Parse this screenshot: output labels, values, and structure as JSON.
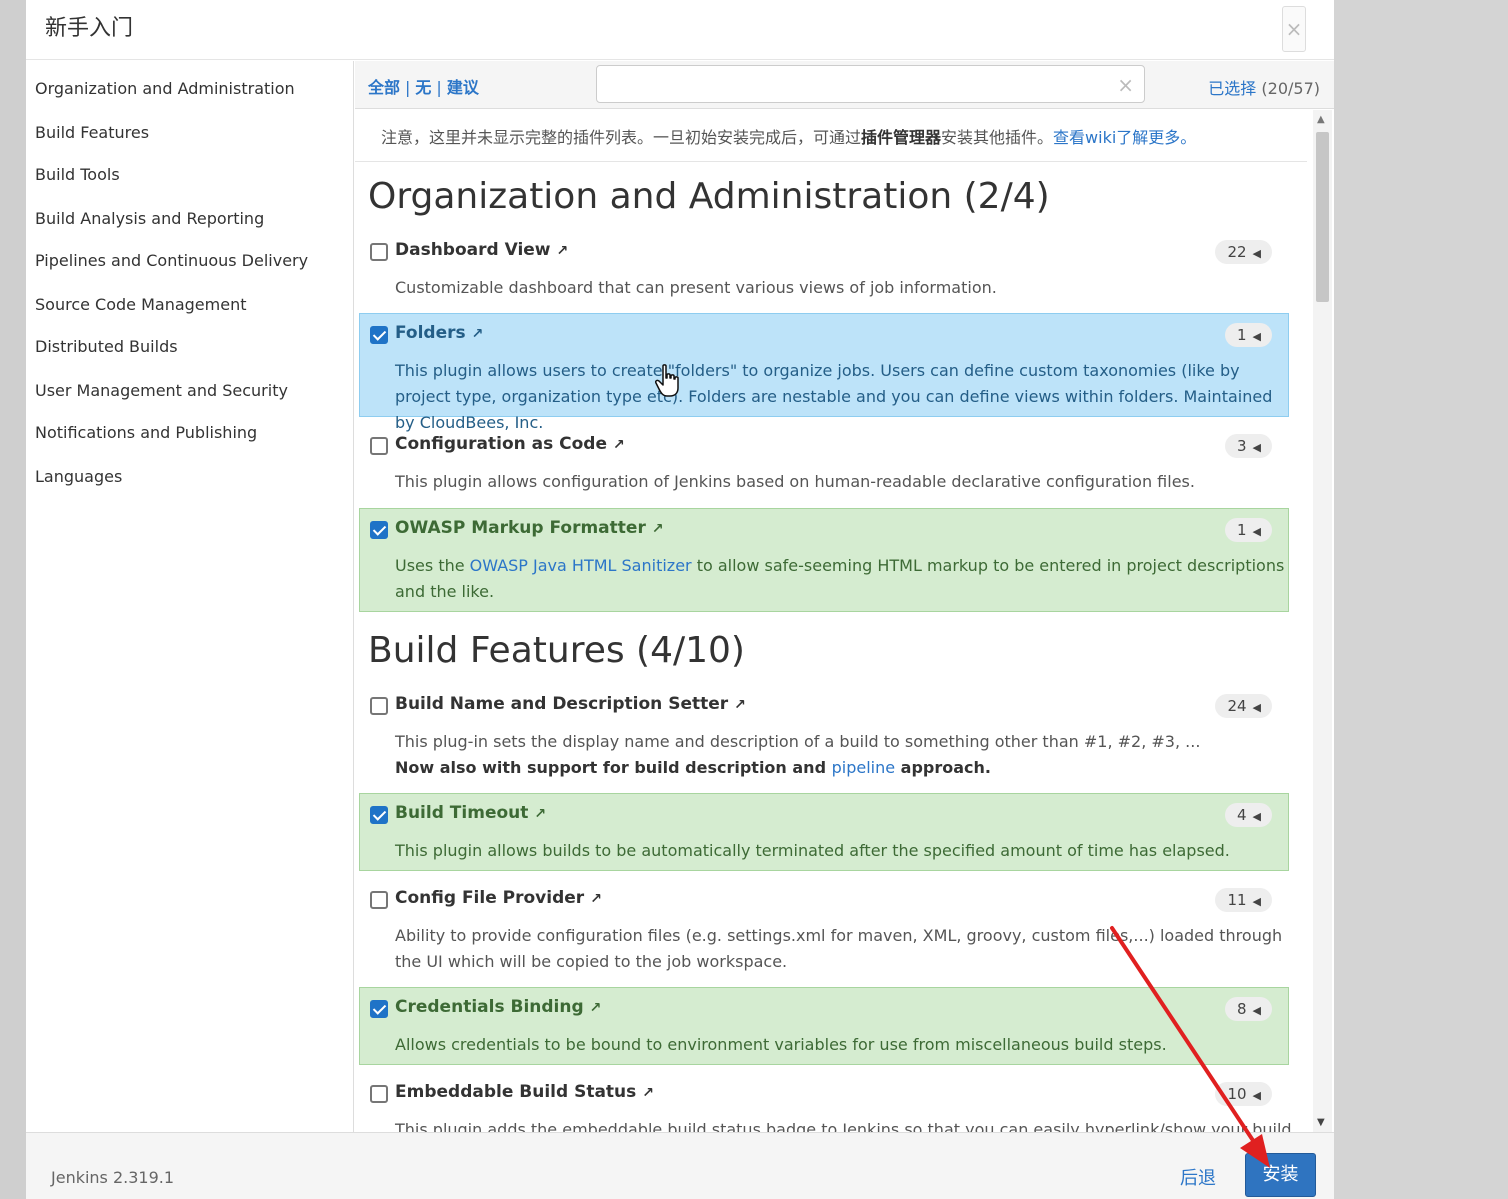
{
  "dialog": {
    "title": "新手入门",
    "close_icon": "×"
  },
  "sidebar": {
    "categories": [
      "Organization and Administration",
      "Build Features",
      "Build Tools",
      "Build Analysis and Reporting",
      "Pipelines and Continuous Delivery",
      "Source Code Management",
      "Distributed Builds",
      "User Management and Security",
      "Notifications and Publishing",
      "Languages"
    ]
  },
  "toolbar": {
    "all": "全部",
    "none": "无",
    "suggested": "建议",
    "separator": "|",
    "search_value": "",
    "clear_icon": "×",
    "selected_label": "已选择",
    "selected_count": "(20/57)"
  },
  "notice": {
    "text1": "注意，这里并未显示完整的插件列表。一旦初始安装完成后，可通过",
    "bold": "插件管理器",
    "text2": "安装其他插件。",
    "link": "查看wiki了解更多。"
  },
  "sections": [
    {
      "title": "Organization and Administration (2/4)",
      "plugins": [
        {
          "name": "Dashboard View",
          "ext": "↗",
          "checked": false,
          "deps": "22",
          "desc": "Customizable dashboard that can present various views of job information."
        },
        {
          "name": "Folders",
          "ext": "↗",
          "checked": true,
          "deps": "1",
          "desc": "This plugin allows users to create \"folders\" to organize jobs. Users can define custom taxonomies (like by project type, organization type etc). Folders are nestable and you can define views within folders. Maintained by CloudBees, Inc."
        },
        {
          "name": "Configuration as Code",
          "ext": "↗",
          "checked": false,
          "deps": "3",
          "desc": "This plugin allows configuration of Jenkins based on human-readable declarative configuration files."
        },
        {
          "name": "OWASP Markup Formatter",
          "ext": "↗",
          "checked": true,
          "deps": "1",
          "desc_pre": "Uses the ",
          "desc_link": "OWASP Java HTML Sanitizer",
          "desc_post": " to allow safe-seeming HTML markup to be entered in project descriptions and the like."
        }
      ]
    },
    {
      "title": "Build Features (4/10)",
      "plugins": [
        {
          "name": "Build Name and Description Setter",
          "ext": "↗",
          "checked": false,
          "deps": "24",
          "desc": "This plug-in sets the display name and description of a build to something other than #1, #2, #3, ...",
          "desc_strong_pre": "Now also with support for build description and ",
          "desc_link": "pipeline",
          "desc_strong_post": " approach."
        },
        {
          "name": "Build Timeout",
          "ext": "↗",
          "checked": true,
          "deps": "4",
          "desc": "This plugin allows builds to be automatically terminated after the specified amount of time has elapsed."
        },
        {
          "name": "Config File Provider",
          "ext": "↗",
          "checked": false,
          "deps": "11",
          "desc": "Ability to provide configuration files (e.g. settings.xml for maven, XML, groovy, custom files,...) loaded through the UI which will be copied to the job workspace."
        },
        {
          "name": "Credentials Binding",
          "ext": "↗",
          "checked": true,
          "deps": "8",
          "desc": "Allows credentials to be bound to environment variables for use from miscellaneous build steps."
        },
        {
          "name": "Embeddable Build Status",
          "ext": "↗",
          "checked": false,
          "deps": "10",
          "desc": "This plugin adds the embeddable build status badge to Jenkins so that you can easily hyperlink/show your build"
        }
      ]
    }
  ],
  "footer": {
    "version": "Jenkins 2.319.1",
    "back": "后退",
    "install": "安装"
  },
  "colors": {
    "accent": "#2c76c8",
    "selected_blue": "#bde3f9",
    "selected_green": "#d5ecd0",
    "annotation_arrow": "#e02020"
  },
  "icons": {
    "external_link": "external-link-icon",
    "dependency_toggle": "caret-left-icon",
    "cursor": "hand-pointer-icon"
  }
}
